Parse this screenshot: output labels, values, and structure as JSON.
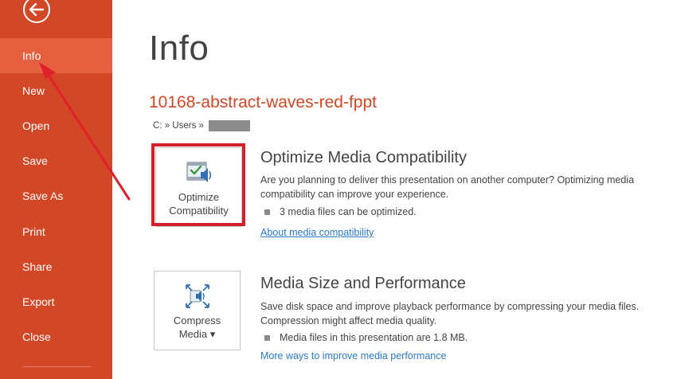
{
  "sidebar": {
    "items": [
      {
        "label": "Info"
      },
      {
        "label": "New"
      },
      {
        "label": "Open"
      },
      {
        "label": "Save"
      },
      {
        "label": "Save As"
      },
      {
        "label": "Print"
      },
      {
        "label": "Share"
      },
      {
        "label": "Export"
      },
      {
        "label": "Close"
      }
    ],
    "active_item": "Info",
    "back_icon": "back-arrow-icon"
  },
  "main": {
    "title": "Info",
    "file_name": "10168-abstract-waves-red-fppt",
    "path_text": "C: » Users »",
    "optimize": {
      "tile_label_line1": "Optimize",
      "tile_label_line2": "Compatibility",
      "title": "Optimize Media Compatibility",
      "description": "Are you planning to deliver this presentation on another computer? Optimizing media compatibility can improve your experience.",
      "bullet": "3 media files can be optimized.",
      "link": "About media compatibility"
    },
    "compress": {
      "tile_label_line1": "Compress",
      "tile_label_line2": "Media ▾",
      "title": "Media Size and Performance",
      "description": "Save disk space and improve playback performance by compressing your media files. Compression might affect media quality.",
      "bullet": "Media files in this presentation are 1.8 MB.",
      "link": "More ways to improve media performance"
    }
  },
  "colors": {
    "sidebar_bg": "#d24726",
    "sidebar_active": "#e5603e",
    "accent_text": "#d24726",
    "highlight": "#d0202a",
    "link": "#2b79c2"
  }
}
